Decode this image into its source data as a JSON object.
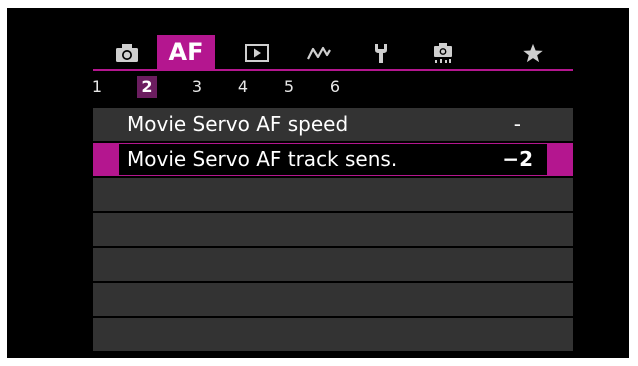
{
  "tabs": [
    {
      "icon": "camera-shooting-icon"
    },
    {
      "label": "AF"
    },
    {
      "icon": "playback-icon"
    },
    {
      "icon": "wireless-icon"
    },
    {
      "icon": "setup-wrench-icon"
    },
    {
      "icon": "custom-functions-icon"
    },
    {
      "icon": "my-menu-star-icon"
    }
  ],
  "active_tab": "AF",
  "subpages": [
    "1",
    "2",
    "3",
    "4",
    "5",
    "6"
  ],
  "active_subpage": "2",
  "menu": {
    "items": [
      {
        "label": "Movie Servo AF speed",
        "value": "-"
      },
      {
        "label": "Movie Servo AF track sens.",
        "value": "−2"
      }
    ],
    "selected_index": 1
  },
  "colors": {
    "accent": "#b4168f",
    "active_subpage_bg": "#6b1d5f",
    "row_bg": "#333333",
    "background": "#000000"
  }
}
